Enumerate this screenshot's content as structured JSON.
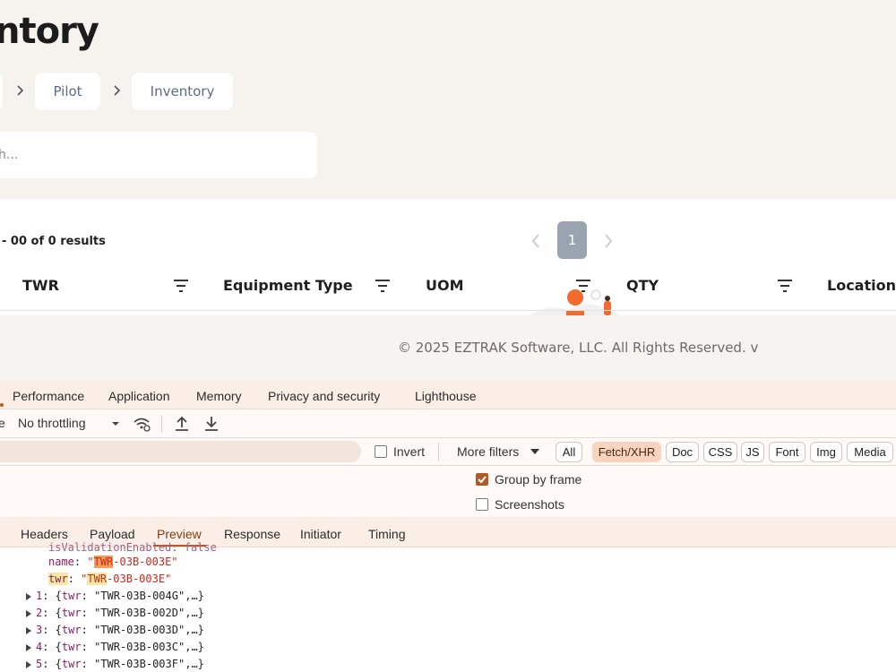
{
  "page": {
    "title": "ntory",
    "breadcrumbs": [
      "",
      "Pilot",
      "Inventory"
    ],
    "search_placeholder": "h..."
  },
  "table": {
    "results_text": "- 00 of 0 results",
    "current_page": "1",
    "columns": [
      "TWR",
      "Equipment Type",
      "UOM",
      "QTY",
      "Location"
    ]
  },
  "footer": {
    "text": "© 2025 EZTRAK Software, LLC. All Rights Reserved. v"
  },
  "devtools": {
    "tabs": [
      "Performance",
      "Application",
      "Memory",
      "Privacy and security",
      "Lighthouse"
    ],
    "toolbar": {
      "prefix": "e",
      "throttling": "No throttling"
    },
    "filters": {
      "invert_label": "Invert",
      "more_filters_label": "More filters",
      "chips": [
        "All",
        "Fetch/XHR",
        "Doc",
        "CSS",
        "JS",
        "Font",
        "Img",
        "Media"
      ],
      "active_chip": "Fetch/XHR"
    },
    "options": {
      "group_by_frame_label": "Group by frame",
      "group_by_frame_checked": true,
      "screenshots_label": "Screenshots",
      "screenshots_checked": false
    },
    "subtabs": [
      "Headers",
      "Payload",
      "Preview",
      "Response",
      "Initiator",
      "Timing"
    ],
    "active_subtab": "Preview",
    "preview": {
      "partial_top_line": "isValidationEnabled: false",
      "name_key": "name",
      "name_value_hl": "TWR",
      "name_value_rest": "-03B-003E\"",
      "twr_key": "twr",
      "twr_value_hl": "TWR",
      "twr_value_rest": "-03B-003E\"",
      "rows": [
        {
          "index": "1",
          "value": "\"TWR-03B-004G\""
        },
        {
          "index": "2",
          "value": "\"TWR-03B-002D\""
        },
        {
          "index": "3",
          "value": "\"TWR-03B-003D\""
        },
        {
          "index": "4",
          "value": "\"TWR-03B-003C\""
        },
        {
          "index": "5",
          "value": "\"TWR-03B-003F\""
        }
      ]
    }
  },
  "colors": {
    "accent": "#b05a25",
    "page_bg": "#f6f2ee",
    "pager_active": "#9aa3b0",
    "chip_active": "#f8d4bf"
  }
}
